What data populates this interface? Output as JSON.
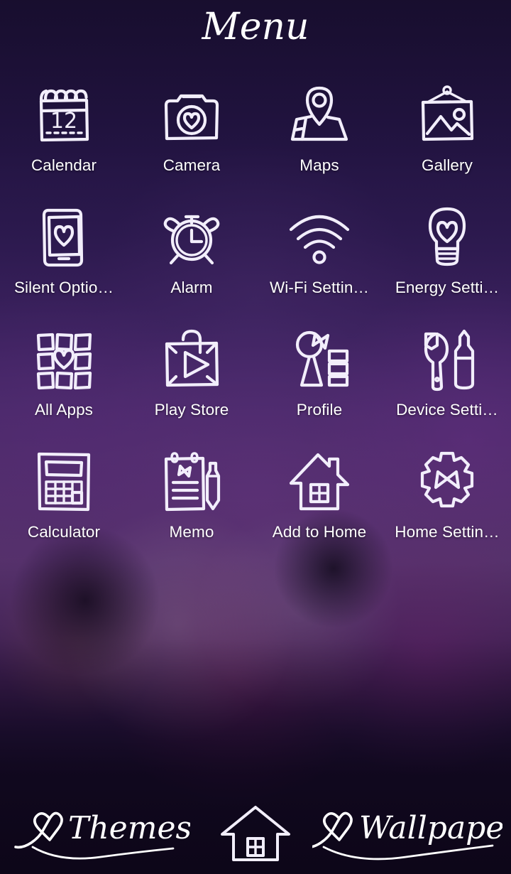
{
  "screen": {
    "title": "Menu",
    "background_top_color": "#1d1138",
    "background_mid_color": "#5b3570",
    "background_bottom_color": "#150a26",
    "icon_stroke_color": "#f2eefb",
    "label_color": "#ffffff"
  },
  "grid": {
    "columns": 4,
    "rows": 4,
    "items": [
      {
        "label": "Calendar",
        "icon": "calendar-icon",
        "day_number": "12"
      },
      {
        "label": "Camera",
        "icon": "camera-heart-icon"
      },
      {
        "label": "Maps",
        "icon": "map-pin-icon"
      },
      {
        "label": "Gallery",
        "icon": "picture-frame-icon"
      },
      {
        "label": "Silent Optio…",
        "icon": "phone-heart-icon"
      },
      {
        "label": "Alarm",
        "icon": "alarm-clock-icon"
      },
      {
        "label": "Wi-Fi Settin…",
        "icon": "wifi-icon"
      },
      {
        "label": "Energy Setti…",
        "icon": "lightbulb-heart-icon"
      },
      {
        "label": "All Apps",
        "icon": "app-grid-heart-icon"
      },
      {
        "label": "Play Store",
        "icon": "shopping-bag-play-icon"
      },
      {
        "label": "Profile",
        "icon": "person-bow-list-icon"
      },
      {
        "label": "Device Setti…",
        "icon": "wrench-screwdriver-icon"
      },
      {
        "label": "Calculator",
        "icon": "calculator-icon"
      },
      {
        "label": "Memo",
        "icon": "notepad-pen-icon"
      },
      {
        "label": "Add to Home",
        "icon": "house-icon"
      },
      {
        "label": "Home Settin…",
        "icon": "gear-bow-icon"
      }
    ]
  },
  "dock": {
    "themes_label": "Themes",
    "themes_icon": "heart-swash-icon",
    "home_icon": "home-button-icon",
    "wallpapers_label": "Wallpapers",
    "wallpapers_icon": "heart-swash-icon"
  }
}
